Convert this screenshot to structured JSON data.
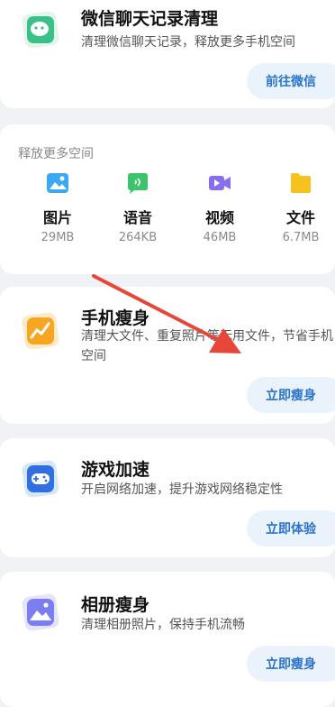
{
  "wechat_card": {
    "title": "微信聊天记录清理",
    "description": "清理微信聊天记录，释放更多手机空间",
    "button": "前往微信",
    "icon": "chat-bubble-icon",
    "icon_color": "#3cc08a"
  },
  "free_space": {
    "title": "释放更多空间",
    "items": [
      {
        "label": "图片",
        "size": "29MB",
        "icon": "image-icon",
        "color": "#3aa8f2"
      },
      {
        "label": "语音",
        "size": "264KB",
        "icon": "voice-icon",
        "color": "#3cc36b"
      },
      {
        "label": "视频",
        "size": "46MB",
        "icon": "video-icon",
        "color": "#8a6cf0"
      },
      {
        "label": "文件",
        "size": "6.7MB",
        "icon": "folder-icon",
        "color": "#f7c21d"
      }
    ]
  },
  "slim_card": {
    "title": "手机瘦身",
    "description": "清理大文件、重复照片等无用文件，节省手机空间",
    "button": "立即瘦身",
    "icon": "slim-chart-icon",
    "icon_color": "#f6a623"
  },
  "game_card": {
    "title": "游戏加速",
    "description": "开启网络加速，提升游戏网络稳定性",
    "button": "立即体验",
    "icon": "gamepad-icon",
    "icon_color": "#2f6fe0"
  },
  "album_card": {
    "title": "相册瘦身",
    "description": "清理相册照片，保持手机流畅",
    "button": "立即瘦身",
    "icon": "photo-album-icon",
    "icon_color": "#7b7ef0"
  },
  "annotation": {
    "arrow_color": "#e8463a"
  }
}
